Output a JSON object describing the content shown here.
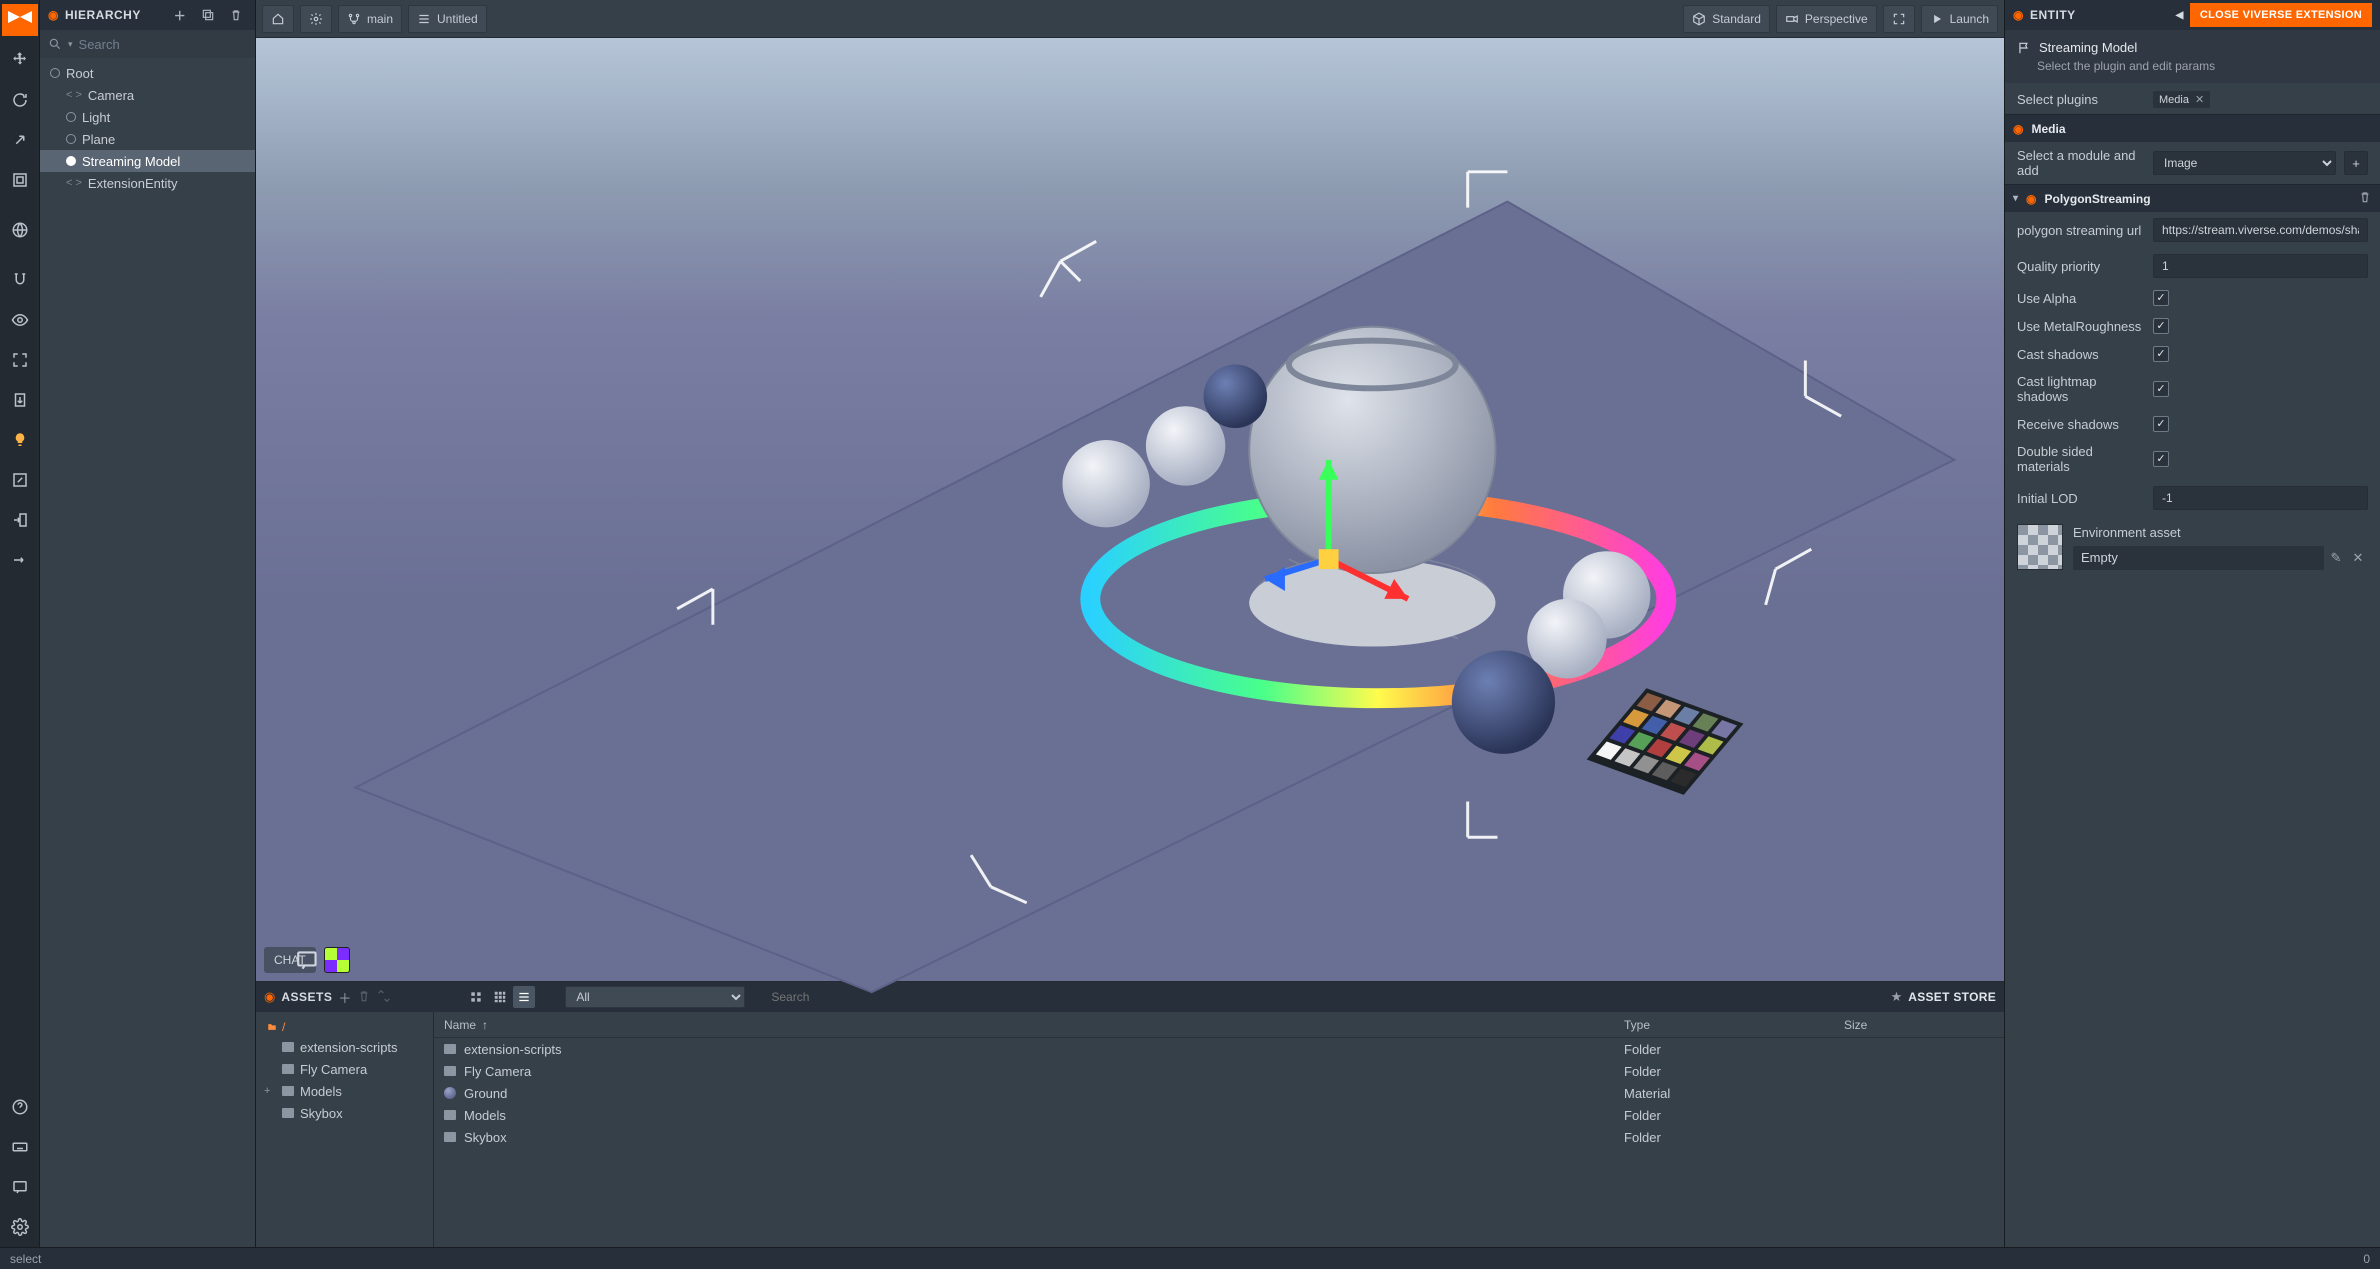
{
  "hierarchy": {
    "title": "HIERARCHY",
    "search_placeholder": "Search",
    "items": [
      "Root",
      "Camera",
      "Light",
      "Plane",
      "Streaming Model",
      "ExtensionEntity"
    ]
  },
  "topbar": {
    "branch": "main",
    "scene": "Untitled",
    "standard": "Standard",
    "perspective": "Perspective",
    "launch": "Launch"
  },
  "chat": {
    "label": "CHAT"
  },
  "assets": {
    "title": "ASSETS",
    "filter": "All",
    "search_placeholder": "Search",
    "store": "ASSET STORE",
    "crumb": "/",
    "folders": [
      "extension-scripts",
      "Fly Camera",
      "Models",
      "Skybox"
    ],
    "cols": {
      "name": "Name",
      "type": "Type",
      "size": "Size"
    },
    "rows": [
      {
        "name": "extension-scripts",
        "type": "Folder",
        "kind": "folder"
      },
      {
        "name": "Fly Camera",
        "type": "Folder",
        "kind": "folder"
      },
      {
        "name": "Ground",
        "type": "Material",
        "kind": "material"
      },
      {
        "name": "Models",
        "type": "Folder",
        "kind": "folder"
      },
      {
        "name": "Skybox",
        "type": "Folder",
        "kind": "folder"
      }
    ]
  },
  "entity": {
    "title": "ENTITY",
    "close": "CLOSE VIVERSE EXTENSION",
    "header_name": "Streaming Model",
    "header_sub": "Select the plugin and edit params",
    "select_plugins_label": "Select plugins",
    "plugin_tag": "Media",
    "media_title": "Media",
    "module_label": "Select a module and add",
    "module_value": "Image",
    "poly_title": "PolygonStreaming",
    "poly_url_label": "polygon streaming url",
    "poly_url_value": "https://stream.viverse.com/demos/shad",
    "quality_label": "Quality priority",
    "quality_value": "1",
    "use_alpha": "Use Alpha",
    "use_metal": "Use MetalRoughness",
    "cast_shadows": "Cast shadows",
    "cast_lightmap": "Cast lightmap shadows",
    "receive_shadows": "Receive shadows",
    "double_sided": "Double sided materials",
    "initial_lod_label": "Initial LOD",
    "initial_lod_value": "-1",
    "env_label": "Environment asset",
    "env_value": "Empty"
  },
  "status": {
    "mode": "select",
    "count": "0"
  }
}
